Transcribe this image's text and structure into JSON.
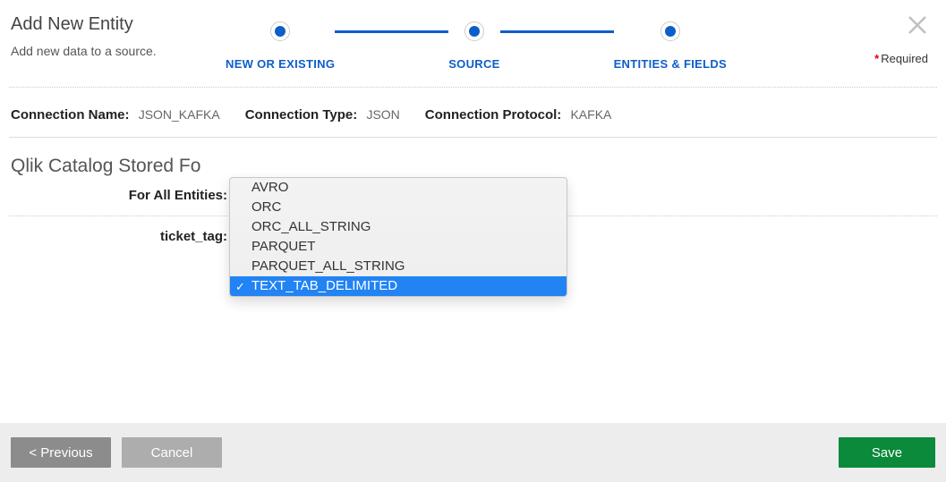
{
  "header": {
    "title": "Add New Entity",
    "subtitle": "Add new data to a source.",
    "required_label": "Required"
  },
  "stepper": {
    "steps": [
      {
        "label": "NEW OR EXISTING"
      },
      {
        "label": "SOURCE"
      },
      {
        "label": "ENTITIES & FIELDS"
      }
    ]
  },
  "connection": {
    "name_label": "Connection Name:",
    "name_value": "JSON_KAFKA",
    "type_label": "Connection Type:",
    "type_value": "JSON",
    "protocol_label": "Connection Protocol:",
    "protocol_value": "KAFKA"
  },
  "section": {
    "title_visible": "Qlik Catalog Stored Fo",
    "for_all_label": "For All Entities:",
    "ticket_label": "ticket_tag:"
  },
  "dropdown": {
    "options": [
      "AVRO",
      "ORC",
      "ORC_ALL_STRING",
      "PARQUET",
      "PARQUET_ALL_STRING",
      "TEXT_TAB_DELIMITED"
    ],
    "selected_index": 5
  },
  "footer": {
    "previous": "< Previous",
    "cancel": "Cancel",
    "save": "Save"
  }
}
